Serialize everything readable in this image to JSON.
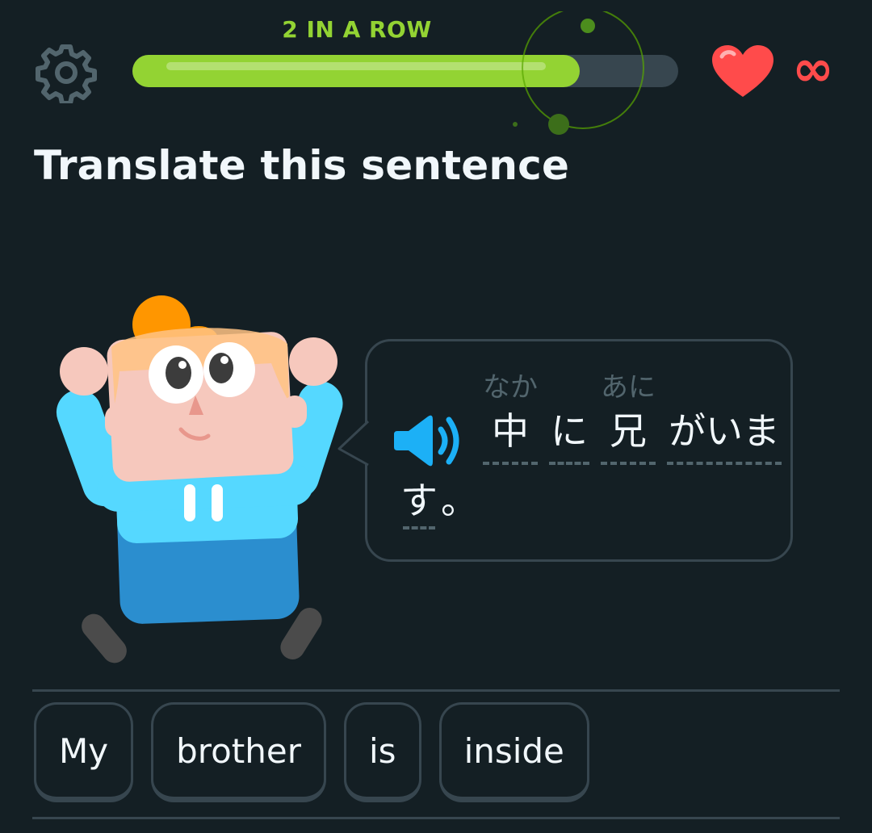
{
  "header": {
    "settings_icon": "gear-icon",
    "streak_label": "2 IN A ROW",
    "progress": 0.82,
    "hearts_icon": "heart-icon",
    "hearts_count": "∞"
  },
  "exercise": {
    "title": "Translate this sentence"
  },
  "prompt": {
    "speaker_icon": "speaker-icon",
    "tokens": [
      {
        "furigana": "なか",
        "text": "中"
      },
      {
        "furigana": "",
        "text": "に"
      },
      {
        "furigana": "あに",
        "text": "兄"
      },
      {
        "furigana": "",
        "text": "がいま"
      }
    ],
    "line2_tokens": [
      {
        "text": "す"
      },
      {
        "text": "。"
      }
    ]
  },
  "word_bank": [
    "My",
    "brother",
    "is",
    "inside"
  ],
  "colors": {
    "background": "#141f24",
    "accent_green": "#93d333",
    "heart_red": "#ff4b4b",
    "border": "#37464f",
    "speaker_blue": "#1cb0f6"
  }
}
